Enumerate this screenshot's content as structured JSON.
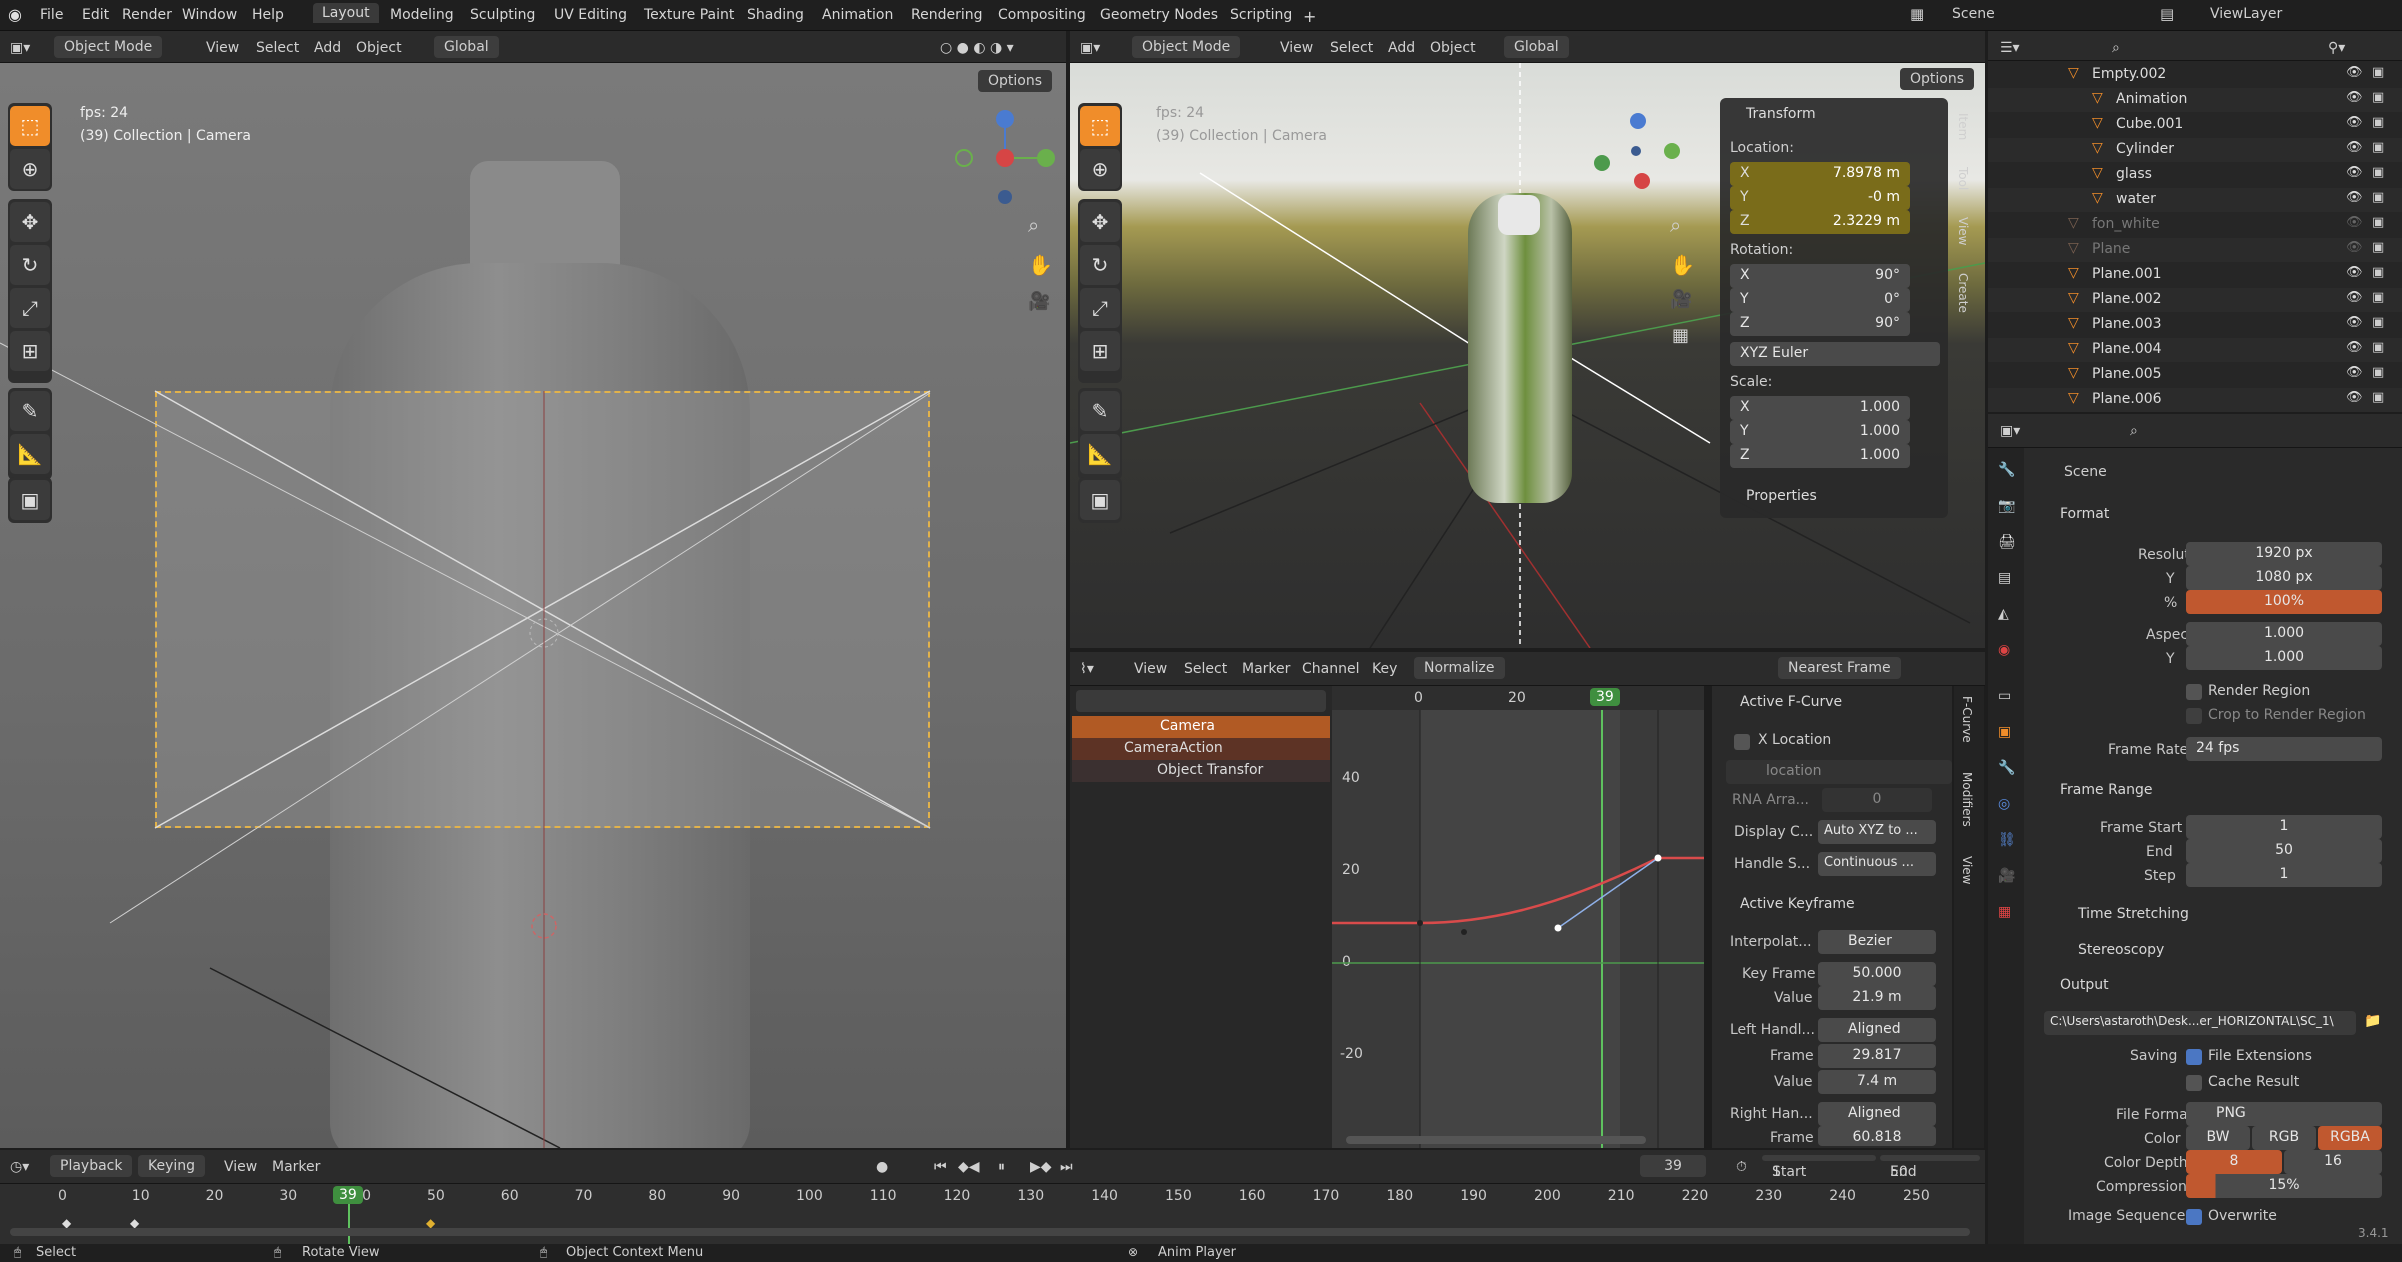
{
  "menu": [
    "File",
    "Edit",
    "Render",
    "Window",
    "Help"
  ],
  "workspaces": [
    "Layout",
    "Modeling",
    "Sculpting",
    "UV Editing",
    "Texture Paint",
    "Shading",
    "Animation",
    "Rendering",
    "Compositing",
    "Geometry Nodes",
    "Scripting"
  ],
  "scene_name": "Scene",
  "view_layer": "ViewLayer",
  "vp1": {
    "mode": "Object Mode",
    "menus": [
      "View",
      "Select",
      "Add",
      "Object"
    ],
    "orient": "Global",
    "options": "Options",
    "fps": "fps: 24",
    "collection": "(39) Collection | Camera"
  },
  "vp2": {
    "mode": "Object Mode",
    "menus": [
      "View",
      "Select",
      "Add",
      "Object"
    ],
    "orient": "Global",
    "options": "Options",
    "fps": "fps: 24",
    "collection": "(39) Collection | Camera",
    "side_tabs": [
      "Item",
      "Tool",
      "View",
      "Create"
    ],
    "transform": {
      "title": "Transform",
      "location": "Location:",
      "loc": [
        [
          "X",
          "7.8978 m"
        ],
        [
          "Y",
          "-0 m"
        ],
        [
          "Z",
          "2.3229 m"
        ]
      ],
      "rotation": "Rotation:",
      "rot": [
        [
          "X",
          "90°"
        ],
        [
          "Y",
          "0°"
        ],
        [
          "Z",
          "90°"
        ]
      ],
      "euler": "XYZ Euler",
      "scale": "Scale:",
      "scl": [
        [
          "X",
          "1.000"
        ],
        [
          "Y",
          "1.000"
        ],
        [
          "Z",
          "1.000"
        ]
      ],
      "properties": "Properties"
    }
  },
  "outliner": {
    "items": [
      {
        "name": "Empty.002"
      },
      {
        "name": "Animation"
      },
      {
        "name": "Cube.001"
      },
      {
        "name": "Cylinder"
      },
      {
        "name": "glass"
      },
      {
        "name": "water"
      },
      {
        "name": "fon_white"
      },
      {
        "name": "Plane"
      },
      {
        "name": "Plane.001"
      },
      {
        "name": "Plane.002"
      },
      {
        "name": "Plane.003"
      },
      {
        "name": "Plane.004"
      },
      {
        "name": "Plane.005"
      },
      {
        "name": "Plane.006"
      }
    ]
  },
  "props": {
    "scene": "Scene",
    "format": "Format",
    "res_x_lbl": "Resolution X",
    "res_x": "1920 px",
    "res_y_lbl": "Y",
    "res_y": "1080 px",
    "pct_lbl": "%",
    "pct": "100%",
    "asp_x_lbl": "Aspect X",
    "asp_x": "1.000",
    "asp_y_lbl": "Y",
    "asp_y": "1.000",
    "render_region": "Render Region",
    "crop": "Crop to Render Region",
    "frame_rate_lbl": "Frame Rate",
    "frame_rate": "24 fps",
    "frame_range": "Frame Range",
    "fs_lbl": "Frame Start",
    "fs": "1",
    "end_lbl": "End",
    "end": "50",
    "step_lbl": "Step",
    "step": "1",
    "time_stretching": "Time Stretching",
    "stereoscopy": "Stereoscopy",
    "output": "Output",
    "path": "C:\\Users\\astaroth\\Desk...er_HORIZONTAL\\SC_1\\",
    "saving_lbl": "Saving",
    "file_ext": "File Extensions",
    "cache": "Cache Result",
    "ff_lbl": "File Format",
    "ff": "PNG",
    "color_lbl": "Color",
    "colors": [
      "BW",
      "RGB",
      "RGBA"
    ],
    "depth_lbl": "Color Depth",
    "depths": [
      "8",
      "16"
    ],
    "comp_lbl": "Compression",
    "comp": "15%",
    "img_seq_lbl": "Image Sequence",
    "overwrite": "Overwrite",
    "version": "3.4.1"
  },
  "graph": {
    "menus": [
      "View",
      "Select",
      "Marker",
      "Channel",
      "Key"
    ],
    "normalize": "Normalize",
    "snap": "Nearest Frame",
    "frame_labels": [
      "0",
      "20"
    ],
    "current": "39",
    "y_labels": [
      "40",
      "20",
      "0",
      "-20"
    ],
    "channels": [
      "Camera",
      "CameraAction",
      "Object Transfor"
    ],
    "tabs": [
      "F-Curve",
      "Modifiers",
      "View"
    ],
    "fcurve": {
      "title": "Active F-Curve",
      "name": "X Location",
      "path": "location",
      "rna_lbl": "RNA Arra...",
      "rna": "0",
      "disp_lbl": "Display C...",
      "disp": "Auto XYZ to ...",
      "handle_lbl": "Handle S...",
      "handle": "Continuous ..."
    },
    "keyframe": {
      "title": "Active Keyframe",
      "interp_lbl": "Interpolat...",
      "interp": "Bezier",
      "kf_lbl": "Key Frame",
      "kf": "50.000",
      "val_lbl": "Value",
      "val": "21.9 m",
      "lh_lbl": "Left Handl...",
      "lh": "Aligned",
      "lf_lbl": "Frame",
      "lf": "29.817",
      "lv_lbl": "Value",
      "lv": "7.4 m",
      "rh_lbl": "Right Han...",
      "rh": "Aligned",
      "rf_lbl": "Frame",
      "rf": "60.818"
    }
  },
  "timeline": {
    "menus": [
      "Playback",
      "Keying",
      "View",
      "Marker"
    ],
    "current": "39",
    "start_lbl": "Start",
    "start": "1",
    "end_lbl": "End",
    "end": "50",
    "ticks": [
      "0",
      "10",
      "20",
      "30",
      "40",
      "50",
      "60",
      "70",
      "80",
      "90",
      "100",
      "110",
      "120",
      "130",
      "140",
      "150",
      "160",
      "170",
      "180",
      "190",
      "200",
      "210",
      "220",
      "230",
      "240",
      "250"
    ]
  },
  "status": {
    "select": "Select",
    "rotate": "Rotate View",
    "ctx": "Object Context Menu",
    "anim": "Anim Player"
  }
}
